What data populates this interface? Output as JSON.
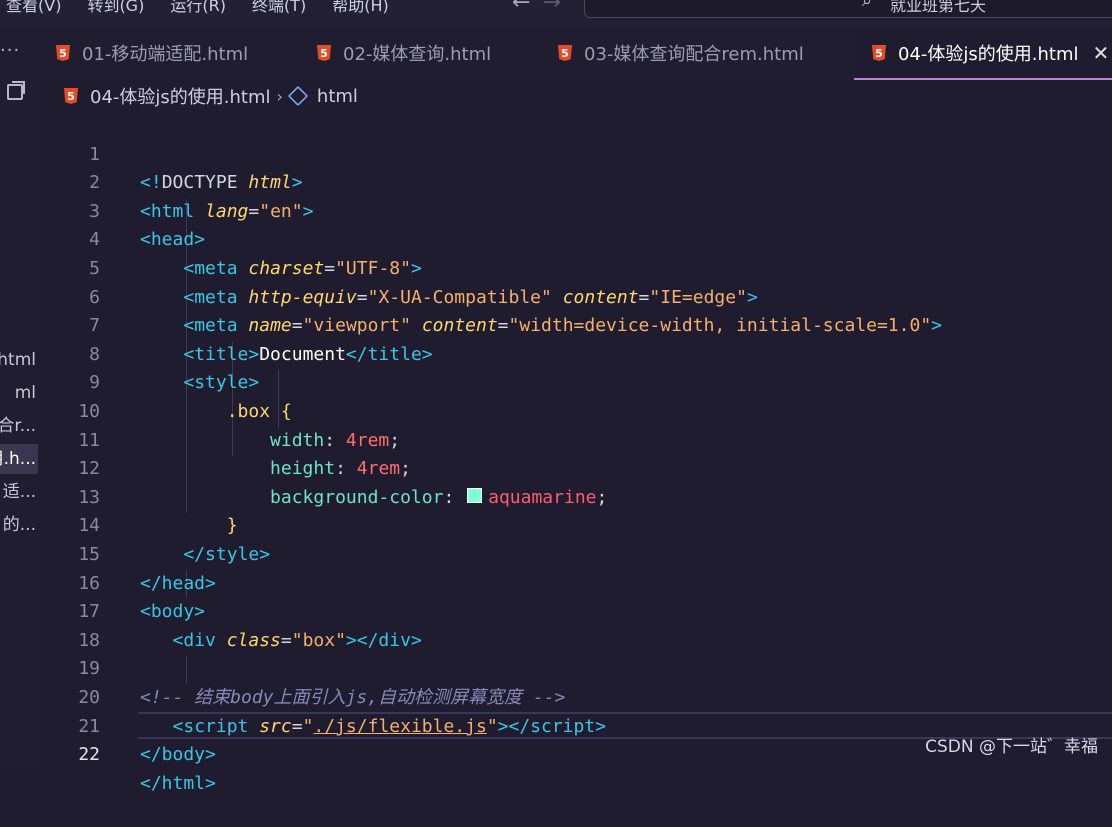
{
  "menubar": {
    "items": [
      "查看(V)",
      "转到(G)",
      "运行(R)",
      "终端(T)",
      "帮助(H)"
    ],
    "search_text": "就业班第七天"
  },
  "sidebar": {
    "files": [
      "html",
      "ml",
      "合r...",
      "用.h...",
      "适...",
      "的..."
    ],
    "active_index": 3
  },
  "tabs": [
    {
      "label": "01-移动端适配.html",
      "active": false
    },
    {
      "label": "02-媒体查询.html",
      "active": false
    },
    {
      "label": "03-媒体查询配合rem.html",
      "active": false
    },
    {
      "label": "04-体验js的使用.html",
      "active": true
    }
  ],
  "tab_icon_label": "5",
  "breadcrumb": {
    "file": "04-体验js的使用.html",
    "symbol": "html"
  },
  "editor": {
    "current_line": 22,
    "line_numbers": [
      "1",
      "2",
      "3",
      "4",
      "5",
      "6",
      "7",
      "8",
      "9",
      "10",
      "11",
      "12",
      "13",
      "14",
      "15",
      "16",
      "17",
      "18",
      "19",
      "20",
      "21",
      "22"
    ]
  },
  "swatch_color": "#7fffd4",
  "watermark": "CSDN @下一站゛幸福",
  "colors": {
    "background": "#1e1c2e",
    "tab_accent": "#c678dd",
    "html5_icon": "#e44d26"
  }
}
